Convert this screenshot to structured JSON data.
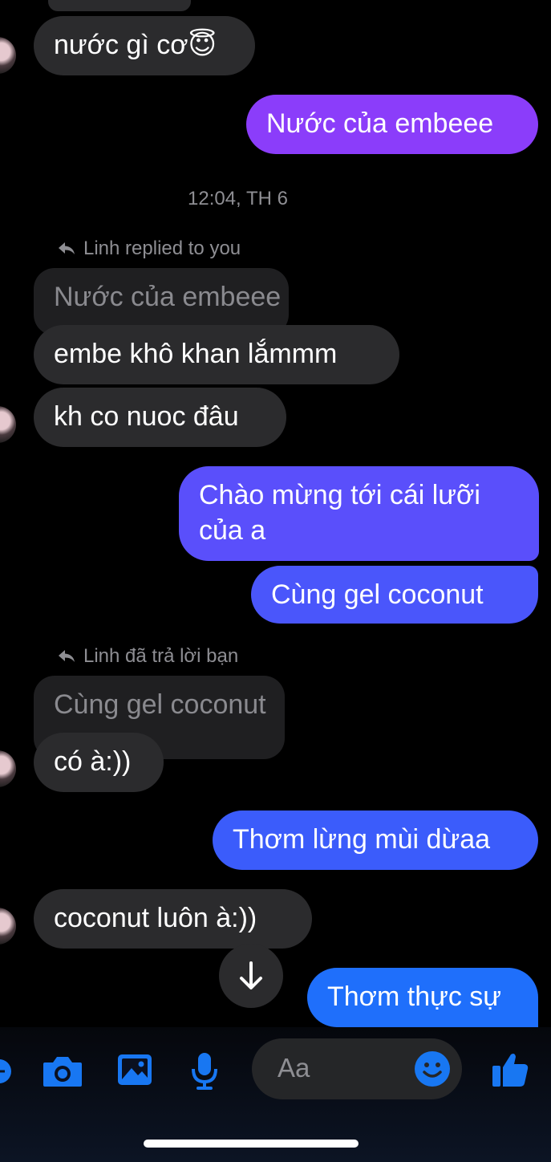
{
  "thread": {
    "m1": "nước gì cơ😇",
    "m2": "Nước của embeee",
    "timestamp": "12:04, TH 6",
    "reply1_label": "Linh replied to you",
    "reply1_quote": "Nước của embeee",
    "m3": "embe khô khan lắmmm",
    "m4": "kh co nuoc đâu",
    "m5_line1": "Chào mừng tới cái lưỡi",
    "m5_line2": "của a",
    "m6": "Cùng gel coconut",
    "reply2_label": "Linh đã trả lời bạn",
    "reply2_quote": "Cùng gel coconut",
    "m7": "có à:))",
    "m8": "Thơm lừng mùi dừaa",
    "m9": "coconut luôn à:))",
    "m10": "Thơm thực sự"
  },
  "composer": {
    "placeholder": "Aa"
  },
  "colors": {
    "incoming": "#2b2b2d",
    "quoted": "#1f1f21",
    "outgoing_top": "#8b3dfa",
    "outgoing_mid": "#5054fb",
    "outgoing_bottom": "#1f6ffb",
    "accent": "#1877f2"
  },
  "icons": [
    "reply-arrow-icon",
    "scroll-down-icon",
    "camera-icon",
    "gallery-icon",
    "microphone-icon",
    "emoji-icon",
    "thumbs-up-icon",
    "plus-icon"
  ]
}
